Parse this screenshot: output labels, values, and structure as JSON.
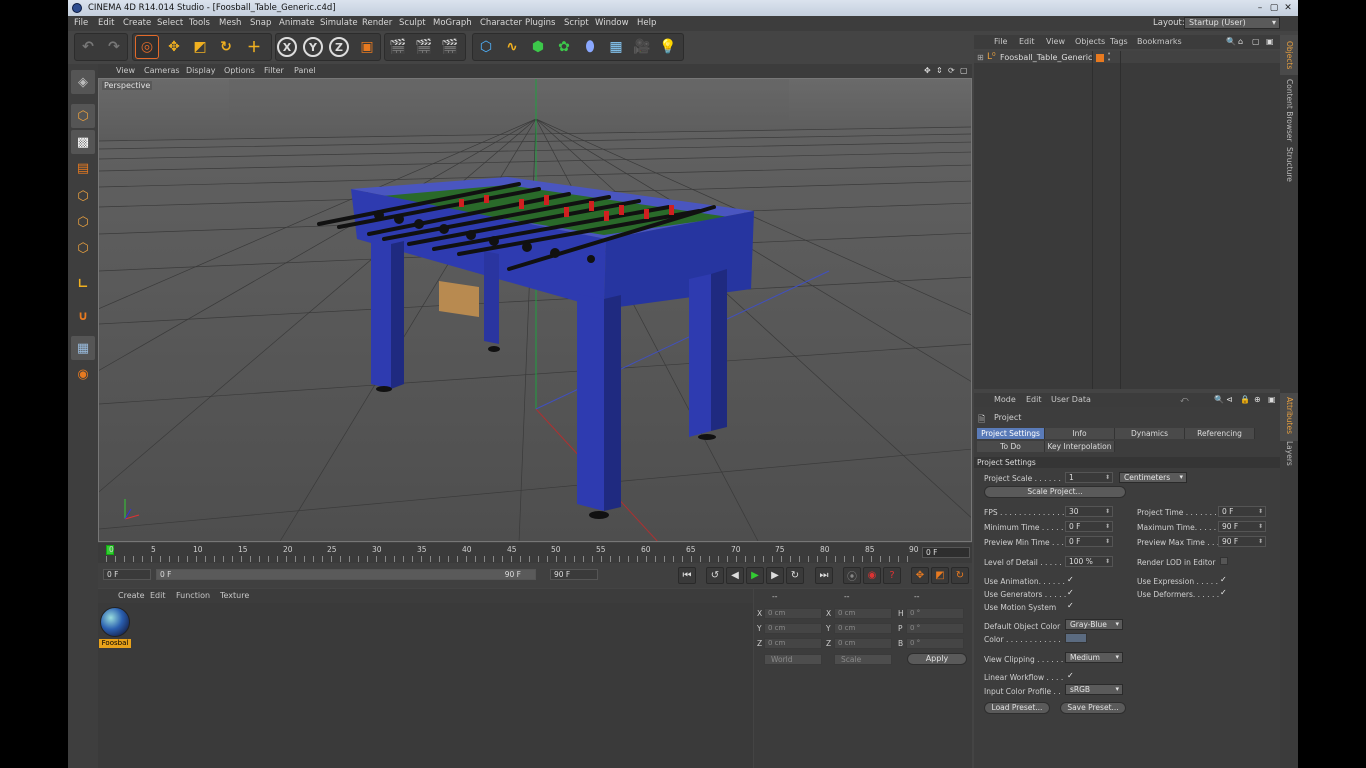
{
  "window": {
    "title": "CINEMA 4D R14.014 Studio - [Foosball_Table_Generic.c4d]"
  },
  "menu": [
    "File",
    "Edit",
    "Create",
    "Select",
    "Tools",
    "Mesh",
    "Snap",
    "Animate",
    "Simulate",
    "Render",
    "Sculpt",
    "MoGraph",
    "Character",
    "Plugins",
    "Script",
    "Window",
    "Help"
  ],
  "layout": {
    "label": "Layout:",
    "value": "Startup (User)"
  },
  "viewport": {
    "menu": [
      "View",
      "Cameras",
      "Display",
      "Options",
      "Filter",
      "Panel"
    ],
    "camera": "Perspective"
  },
  "timeline": {
    "ticks": [
      "0",
      "5",
      "10",
      "15",
      "20",
      "25",
      "30",
      "35",
      "40",
      "45",
      "50",
      "55",
      "60",
      "65",
      "70",
      "75",
      "80",
      "85",
      "90"
    ],
    "end_field": "0 F",
    "start": "0 F",
    "range_start": "0 F",
    "range_end": "90 F",
    "end": "90 F"
  },
  "material": {
    "menu": [
      "Create",
      "Edit",
      "Function",
      "Texture"
    ],
    "name": "Foosbal"
  },
  "coordinates": {
    "header_left": "--",
    "header_mid": "--",
    "header_right": "--",
    "rows": [
      {
        "a": "X",
        "av": "0 cm",
        "b": "X",
        "bv": "0 cm",
        "c": "H",
        "cv": "0 °"
      },
      {
        "a": "Y",
        "av": "0 cm",
        "b": "Y",
        "bv": "0 cm",
        "c": "P",
        "cv": "0 °"
      },
      {
        "a": "Z",
        "av": "0 cm",
        "b": "Z",
        "bv": "0 cm",
        "c": "B",
        "cv": "0 °"
      }
    ],
    "world": "World",
    "scale": "Scale",
    "apply": "Apply"
  },
  "objects": {
    "menu": [
      "File",
      "Edit",
      "View",
      "Objects",
      "Tags",
      "Bookmarks"
    ],
    "item": "Foosball_Table_Generic"
  },
  "side_tabs": [
    "Objects",
    "Content Browser",
    "Structure"
  ],
  "side_tabs_lower": [
    "Attributes",
    "Layers"
  ],
  "attributes": {
    "menu": [
      "Mode",
      "Edit",
      "User Data"
    ],
    "object": "Project",
    "tabs": [
      "Project Settings",
      "Info",
      "Dynamics",
      "Referencing"
    ],
    "tabs2": [
      "To Do",
      "Key Interpolation"
    ],
    "section": "Project Settings",
    "project_scale_label": "Project Scale . . . . . .",
    "project_scale": "1",
    "scale_unit": "Centimeters",
    "scale_project_btn": "Scale Project...",
    "fps_label": "FPS . . . . . . . . . . . . . .",
    "fps": "30",
    "project_time_label": "Project Time . . . . . . .",
    "project_time": "0 F",
    "min_time_label": "Minimum Time . . . . . .",
    "min_time": "0 F",
    "max_time_label": "Maximum Time. . . . . .",
    "max_time": "90 F",
    "prev_min_label": "Preview Min Time . . .",
    "prev_min": "0 F",
    "prev_max_label": "Preview Max Time . . .",
    "prev_max": "90 F",
    "lod_label": "Level of Detail . . . . .",
    "lod": "100 %",
    "render_lod_label": "Render LOD in Editor",
    "use_anim": "Use Animation. . . . . .",
    "use_expr": "Use Expression . . . . .",
    "use_gen": "Use Generators . . . . .",
    "use_def": "Use Deformers. . . . . .",
    "use_motion": "Use Motion System",
    "def_color_label": "Default Object Color",
    "def_color": "Gray-Blue",
    "color_label": "Color . . . . . . . . . . . .",
    "view_clip_label": "View Clipping . . . . . .",
    "view_clip": "Medium",
    "linear_label": "Linear Workflow . . . .",
    "icp_label": "Input Color Profile . .",
    "icp": "sRGB",
    "load_preset": "Load Preset...",
    "save_preset": "Save Preset...",
    "check": "✓"
  }
}
